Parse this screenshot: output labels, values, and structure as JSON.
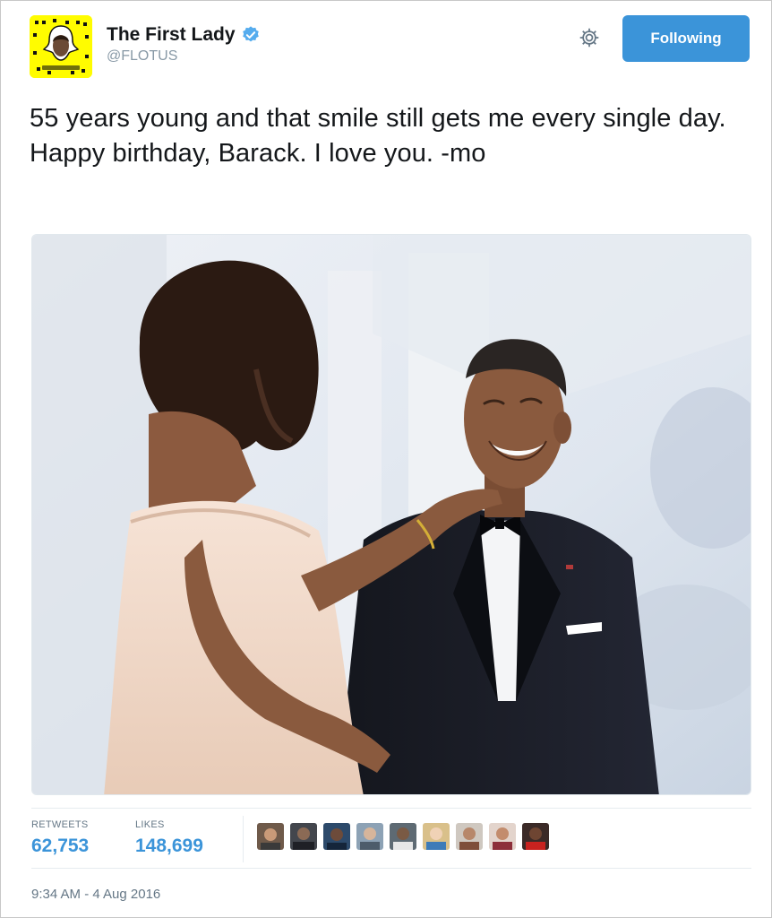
{
  "user": {
    "display_name": "The First Lady",
    "handle": "@FLOTUS"
  },
  "header": {
    "follow_label": "Following"
  },
  "tweet": {
    "text": "55 years young and that smile still gets me every single day. Happy birthday, Barack. I love you. -mo"
  },
  "stats": {
    "retweets_label": "RETWEETS",
    "retweets": "62,753",
    "likes_label": "LIKES",
    "likes": "148,699"
  },
  "timestamp": "9:34 AM - 4 Aug 2016",
  "icons": {
    "verified": "verified-badge-icon",
    "gear": "gear-icon",
    "avatar": "snapcode-avatar"
  },
  "colors": {
    "accent": "#3b94d9",
    "snapcode": "#fffc00"
  }
}
